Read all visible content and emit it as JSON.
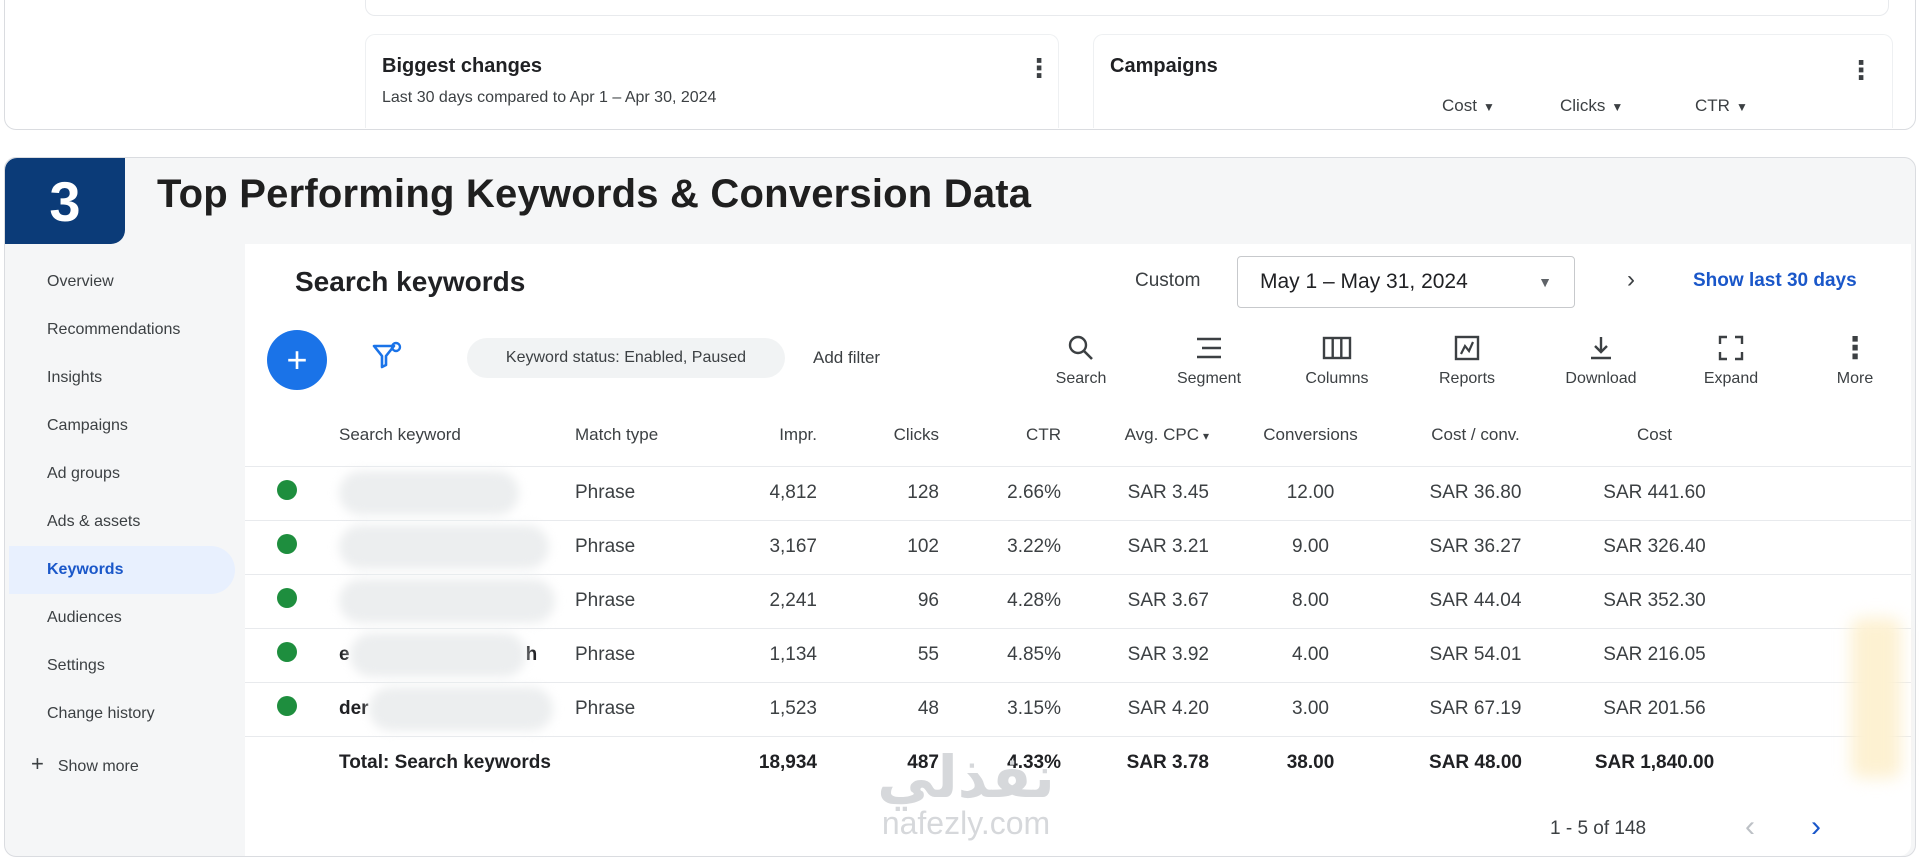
{
  "top_panel": {
    "biggest_changes": {
      "title": "Biggest changes",
      "subtitle": "Last 30 days compared to Apr 1 – Apr 30, 2024"
    },
    "campaigns": {
      "title": "Campaigns",
      "metrics": [
        "Cost",
        "Clicks",
        "CTR"
      ]
    }
  },
  "section": {
    "number": "3",
    "title": "Top Performing Keywords & Conversion Data"
  },
  "sidebar": {
    "items": [
      {
        "label": "Overview"
      },
      {
        "label": "Recommendations"
      },
      {
        "label": "Insights"
      },
      {
        "label": "Campaigns"
      },
      {
        "label": "Ad groups"
      },
      {
        "label": "Ads & assets"
      },
      {
        "label": "Keywords",
        "active": true
      },
      {
        "label": "Audiences"
      },
      {
        "label": "Settings"
      },
      {
        "label": "Change history"
      }
    ],
    "show_more": "Show more"
  },
  "main": {
    "title": "Search keywords",
    "custom_label": "Custom",
    "date_range": "May 1 – May 31, 2024",
    "show_last": "Show last 30 days",
    "filter_chip": "Keyword status: Enabled, Paused",
    "add_filter": "Add filter",
    "tools": [
      "Search",
      "Segment",
      "Columns",
      "Reports",
      "Download",
      "Expand",
      "More"
    ],
    "table": {
      "columns": [
        "Search keyword",
        "Match type",
        "Impr.",
        "Clicks",
        "CTR",
        "Avg. CPC",
        "Conversions",
        "Cost / conv.",
        "Cost"
      ],
      "rows": [
        {
          "keyword": "",
          "match": "Phrase",
          "impr": "4,812",
          "clicks": "128",
          "ctr": "2.66%",
          "cpc": "SAR 3.45",
          "conv": "12.00",
          "cost_conv": "SAR 36.80",
          "cost": "SAR 441.60"
        },
        {
          "keyword": "",
          "match": "Phrase",
          "impr": "3,167",
          "clicks": "102",
          "ctr": "3.22%",
          "cpc": "SAR 3.21",
          "conv": "9.00",
          "cost_conv": "SAR 36.27",
          "cost": "SAR 326.40"
        },
        {
          "keyword": "",
          "match": "Phrase",
          "impr": "2,241",
          "clicks": "96",
          "ctr": "4.28%",
          "cpc": "SAR 3.67",
          "conv": "8.00",
          "cost_conv": "SAR 44.04",
          "cost": "SAR 352.30"
        },
        {
          "keyword_start": "e",
          "keyword_end": "h",
          "match": "Phrase",
          "impr": "1,134",
          "clicks": "55",
          "ctr": "4.85%",
          "cpc": "SAR 3.92",
          "conv": "4.00",
          "cost_conv": "SAR 54.01",
          "cost": "SAR 216.05"
        },
        {
          "keyword_start": "der",
          "keyword_end": "",
          "match": "Phrase",
          "impr": "1,523",
          "clicks": "48",
          "ctr": "3.15%",
          "cpc": "SAR 4.20",
          "conv": "3.00",
          "cost_conv": "SAR 67.19",
          "cost": "SAR 201.56"
        }
      ],
      "total": {
        "label": "Total: Search keywords",
        "impr": "18,934",
        "clicks": "487",
        "ctr": "4.33%",
        "cpc": "SAR 3.78",
        "conv": "38.00",
        "cost_conv": "SAR 48.00",
        "cost": "SAR 1,840.00"
      }
    },
    "pagination": "1 - 5 of 148"
  },
  "watermark": {
    "arabic": "نفذلي",
    "latin": "nafezly.com"
  },
  "colors": {
    "brand_navy": "#0b3b78",
    "google_blue": "#1a73e8",
    "link_blue": "#1a57c9",
    "status_green": "#1e8e3e"
  }
}
